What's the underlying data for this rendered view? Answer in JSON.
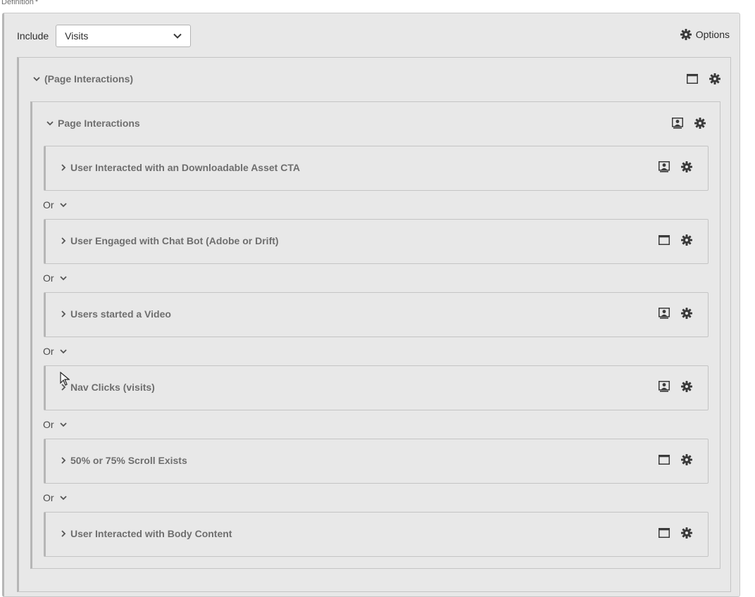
{
  "definition": {
    "label": "Definition",
    "required_mark": "*"
  },
  "include": {
    "label": "Include",
    "selected": "Visits"
  },
  "options": {
    "label": "Options"
  },
  "outer_container": {
    "title": "(Page Interactions)"
  },
  "inner_container": {
    "title": "Page Interactions"
  },
  "operator": "Or",
  "rules": [
    {
      "title": "User Interacted with an Downloadable Asset CTA",
      "icon": "segment-person-icon"
    },
    {
      "title": "User Engaged with Chat Bot (Adobe or Drift)",
      "icon": "window-icon"
    },
    {
      "title": "Users started a Video",
      "icon": "segment-person-icon"
    },
    {
      "title": "Nav Clicks (visits)",
      "icon": "segment-person-icon"
    },
    {
      "title": "50% or 75% Scroll Exists",
      "icon": "window-icon"
    },
    {
      "title": "User Interacted with Body Content",
      "icon": "window-icon"
    }
  ],
  "colors": {
    "panel_bg": "#e8e8e8",
    "border": "#c4c4c4",
    "accent_border": "#b6b6b6",
    "title_text": "#6e6e6e",
    "icon": "#3a3a3a"
  }
}
